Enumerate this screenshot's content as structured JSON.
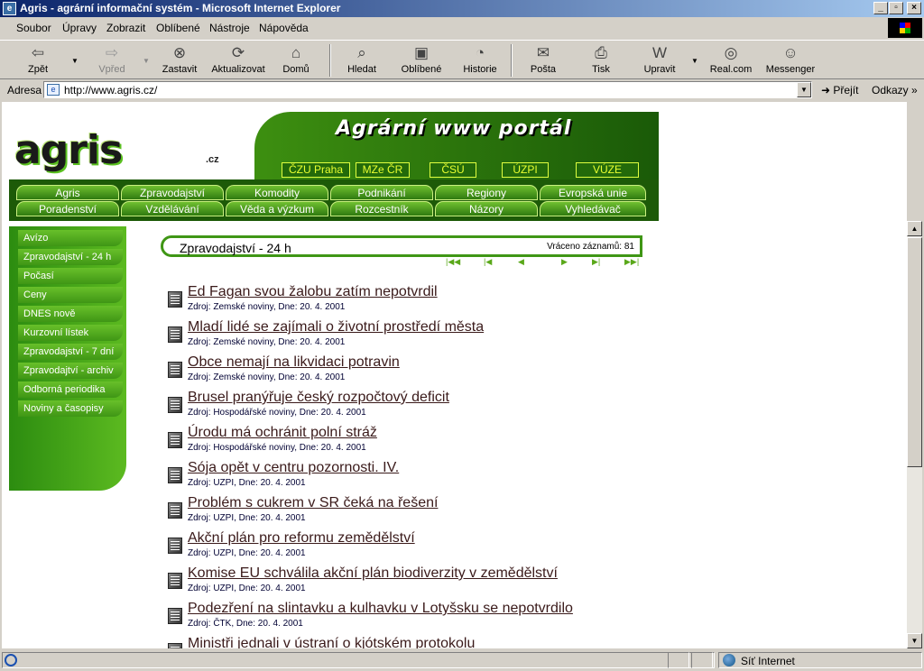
{
  "window": {
    "title": "Agris - agrární informační systém - Microsoft Internet Explorer"
  },
  "menu": [
    "Soubor",
    "Úpravy",
    "Zobrazit",
    "Oblíbené",
    "Nástroje",
    "Nápověda"
  ],
  "toolbar": [
    {
      "label": "Zpět",
      "icon": "back-arrow-icon"
    },
    {
      "label": "Vpřed",
      "icon": "forward-arrow-icon"
    },
    {
      "label": "Zastavit",
      "icon": "stop-icon"
    },
    {
      "label": "Aktualizovat",
      "icon": "refresh-icon"
    },
    {
      "label": "Domů",
      "icon": "home-icon"
    },
    {
      "label": "Hledat",
      "icon": "search-icon"
    },
    {
      "label": "Oblíbené",
      "icon": "favorites-icon"
    },
    {
      "label": "Historie",
      "icon": "history-icon"
    },
    {
      "label": "Pošta",
      "icon": "mail-icon"
    },
    {
      "label": "Tisk",
      "icon": "print-icon"
    },
    {
      "label": "Upravit",
      "icon": "edit-icon"
    },
    {
      "label": "Real.com",
      "icon": "realcom-icon"
    },
    {
      "label": "Messenger",
      "icon": "messenger-icon"
    }
  ],
  "address": {
    "label": "Adresa",
    "url": "http://www.agris.cz/",
    "go": "Přejít",
    "links": "Odkazy"
  },
  "site": {
    "logo": "agris",
    "logo_cz": ".cz",
    "portal_title": "Agrární www portál",
    "portal_links": [
      "ČZU Praha",
      "MZe ČR",
      "ČSÚ",
      "ÚZPI",
      "VÚZE"
    ],
    "nav_row1": [
      "Agris",
      "Zpravodajství",
      "Komodity",
      "Podnikání",
      "Regiony",
      "Evropská unie"
    ],
    "nav_row2": [
      "Poradenství",
      "Vzdělávání",
      "Věda a výzkum",
      "Rozcestník",
      "Názory",
      "Vyhledávač"
    ],
    "sidebar": [
      "Avízo",
      "Zpravodajství - 24 h",
      "Počasí",
      "Ceny",
      "DNES nově",
      "Kurzovní lístek",
      "Zpravodajství - 7 dní",
      "Zpravodajtví - archiv",
      "Odborná periodika",
      "Noviny a časopisy"
    ],
    "section_title": "Zpravodajství - 24 h",
    "count_text": "Vráceno záznamů: 81",
    "news": [
      {
        "title": "Ed Fagan svou žalobu zatím nepotvrdil",
        "src": "Zdroj: Zemské noviny, Dne: 20. 4. 2001"
      },
      {
        "title": "Mladí lidé se zajímali o životní prostředí města",
        "src": "Zdroj: Zemské noviny, Dne: 20. 4. 2001"
      },
      {
        "title": "Obce nemají na likvidaci potravin",
        "src": "Zdroj: Zemské noviny, Dne: 20. 4. 2001"
      },
      {
        "title": "Brusel pranýřuje český rozpočtový deficit",
        "src": "Zdroj: Hospodářské noviny, Dne: 20. 4. 2001"
      },
      {
        "title": "Úrodu má ochránit polní stráž",
        "src": "Zdroj: Hospodářské noviny, Dne: 20. 4. 2001"
      },
      {
        "title": "Sója opět v centru pozornosti. IV.",
        "src": "Zdroj: UZPI, Dne: 20. 4. 2001"
      },
      {
        "title": "Problém s cukrem v SR čeká na řešení",
        "src": "Zdroj: UZPI, Dne: 20. 4. 2001"
      },
      {
        "title": "Akční plán pro reformu zemědělství",
        "src": "Zdroj: UZPI, Dne: 20. 4. 2001"
      },
      {
        "title": "Komise EU schválila akční plán biodiverzity v zemědělství",
        "src": "Zdroj: UZPI, Dne: 20. 4. 2001"
      },
      {
        "title": "Podezření na slintavku a kulhavku v Lotyšsku se nepotvrdilo",
        "src": "Zdroj: ČTK, Dne: 20. 4. 2001"
      },
      {
        "title": "Ministři jednali v ústraní o kjótském protokolu",
        "src": ""
      }
    ]
  },
  "status": {
    "zone": "Síť Internet"
  }
}
